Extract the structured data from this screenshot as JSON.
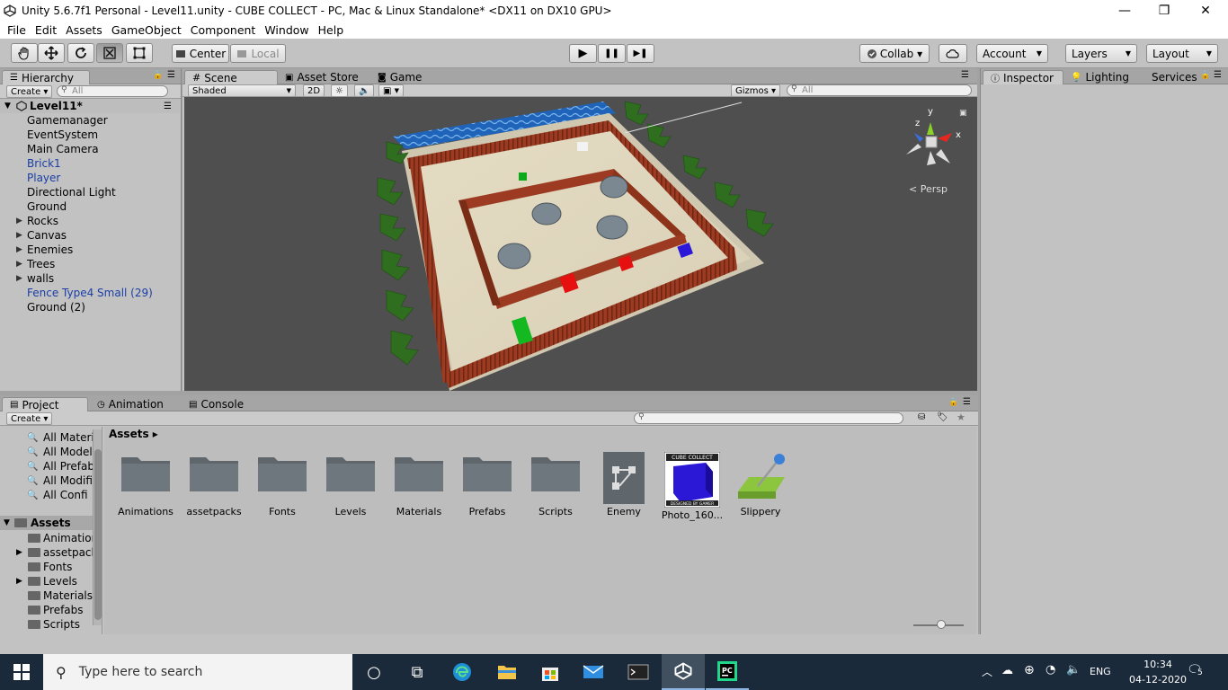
{
  "window": {
    "title": "Unity 5.6.7f1 Personal - Level11.unity - CUBE COLLECT - PC, Mac & Linux Standalone* <DX11 on DX10 GPU>",
    "minimize": "—",
    "restore": "❐",
    "close": "✕"
  },
  "menu": [
    "File",
    "Edit",
    "Assets",
    "GameObject",
    "Component",
    "Window",
    "Help"
  ],
  "toolbar": {
    "tools": [
      "hand-tool",
      "move-tool",
      "rotate-tool",
      "scale-tool",
      "rect-tool"
    ],
    "pivot": "Center",
    "space": "Local",
    "play": "▶",
    "pause": "❚❚",
    "step": "▶❚",
    "collab": "Collab ▾",
    "cloud": "☁",
    "account": "Account",
    "layers": "Layers",
    "layout": "Layout"
  },
  "hierarchy": {
    "tab": "Hierarchy",
    "create": "Create ▾",
    "search_placeholder": "All",
    "scene": "Level11*",
    "items": [
      {
        "label": "Gamemanager",
        "color": "black",
        "expandable": false
      },
      {
        "label": "EventSystem",
        "color": "black",
        "expandable": false
      },
      {
        "label": "Main Camera",
        "color": "black",
        "expandable": false
      },
      {
        "label": "Brick1",
        "color": "blue",
        "expandable": false
      },
      {
        "label": "Player",
        "color": "blue",
        "expandable": false
      },
      {
        "label": "Directional Light",
        "color": "black",
        "expandable": false
      },
      {
        "label": "Ground",
        "color": "black",
        "expandable": false
      },
      {
        "label": "Rocks",
        "color": "black",
        "expandable": true
      },
      {
        "label": "Canvas",
        "color": "black",
        "expandable": true
      },
      {
        "label": "Enemies",
        "color": "black",
        "expandable": true
      },
      {
        "label": "Trees",
        "color": "black",
        "expandable": true
      },
      {
        "label": "walls",
        "color": "black",
        "expandable": true
      },
      {
        "label": "Fence Type4 Small (29)",
        "color": "blue",
        "expandable": false
      },
      {
        "label": "Ground (2)",
        "color": "black",
        "expandable": false
      }
    ]
  },
  "scene_tabs": {
    "scene": "Scene",
    "asset_store": "Asset Store",
    "game": "Game",
    "shading": "Shaded",
    "mode_2d": "2D",
    "gizmos": "Gizmos ▾",
    "search_placeholder": "All",
    "persp": "Persp",
    "axis_y": "y",
    "axis_x": "x",
    "axis_z": "z"
  },
  "inspector": {
    "tab": "Inspector",
    "lighting": "Lighting",
    "services": "Services"
  },
  "project": {
    "tab": "Project",
    "animation": "Animation",
    "console": "Console",
    "create": "Create ▾",
    "favorites": [
      "All Materi",
      "All Model",
      "All Prefab",
      "All Modifi",
      "All Confi"
    ],
    "assets_root": "Assets",
    "tree": [
      {
        "label": "Animation",
        "expandable": false
      },
      {
        "label": "assetpack",
        "expandable": true
      },
      {
        "label": "Fonts",
        "expandable": false
      },
      {
        "label": "Levels",
        "expandable": true
      },
      {
        "label": "Materials",
        "expandable": false
      },
      {
        "label": "Prefabs",
        "expandable": false
      },
      {
        "label": "Scripts",
        "expandable": false
      }
    ],
    "breadcrumb": "Assets ▸",
    "assets": [
      {
        "label": "Animations",
        "kind": "folder"
      },
      {
        "label": "assetpacks",
        "kind": "folder"
      },
      {
        "label": "Fonts",
        "kind": "folder"
      },
      {
        "label": "Levels",
        "kind": "folder"
      },
      {
        "label": "Materials",
        "kind": "folder"
      },
      {
        "label": "Prefabs",
        "kind": "folder"
      },
      {
        "label": "Scripts",
        "kind": "folder"
      },
      {
        "label": "Enemy",
        "kind": "animator"
      },
      {
        "label": "Photo_160...",
        "kind": "image"
      },
      {
        "label": "Slippery",
        "kind": "physics-material"
      }
    ],
    "thumbnail_text_top": "CUBE COLLECT",
    "thumbnail_text_bottom": "DESIGNED BY GAMER"
  },
  "taskbar": {
    "search_placeholder": "Type here to search",
    "language": "ENG",
    "time": "10:34",
    "date": "04-12-2020",
    "notifications": "5"
  }
}
